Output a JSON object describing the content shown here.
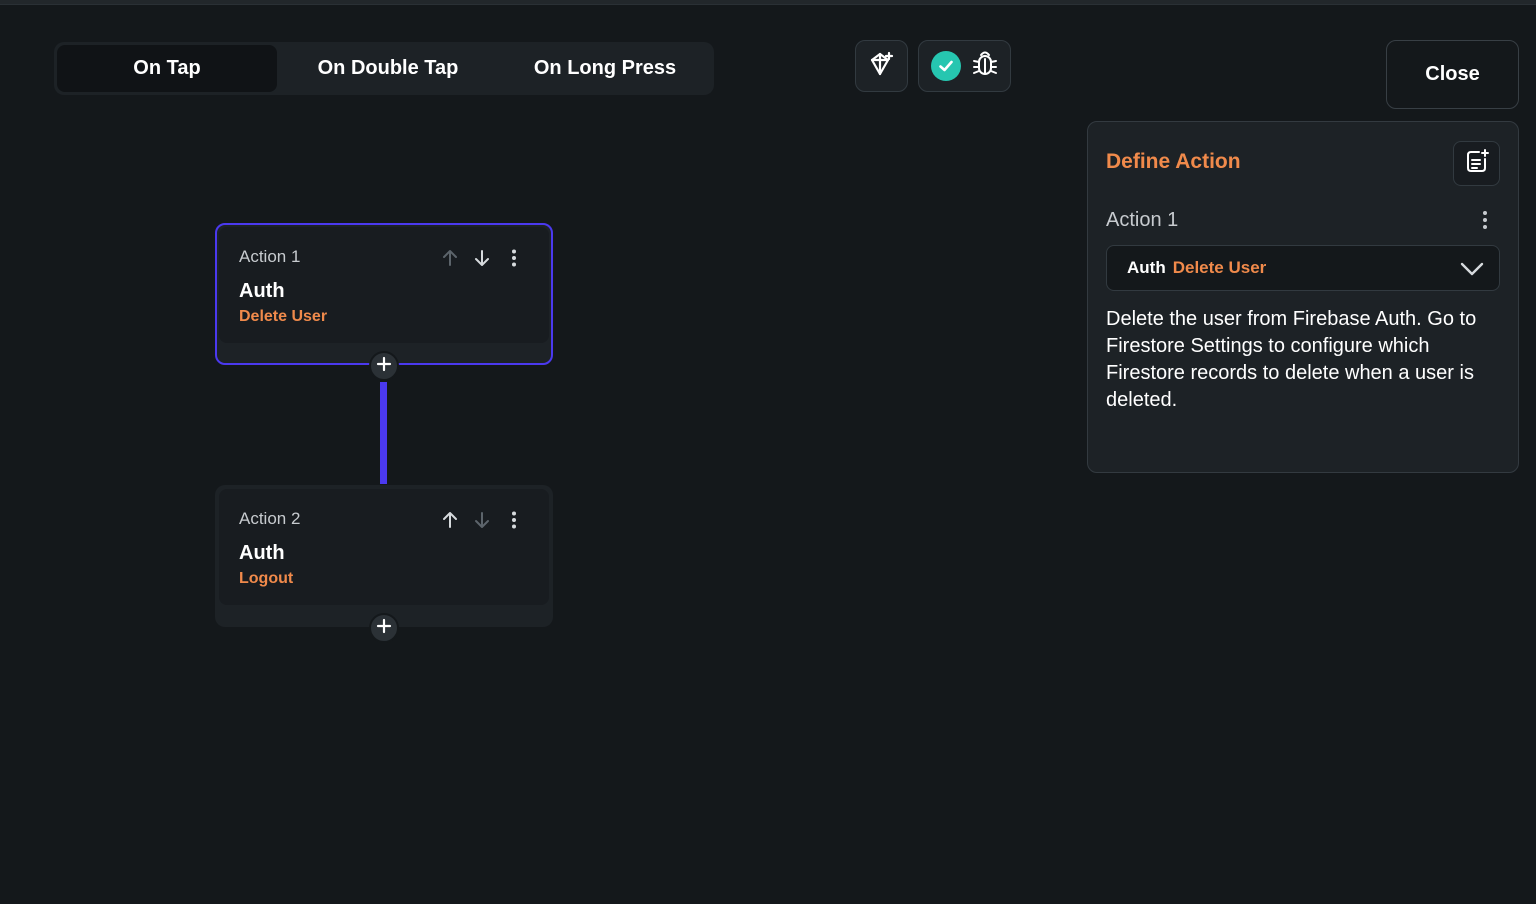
{
  "tabs": [
    {
      "label": "On Tap",
      "active": true
    },
    {
      "label": "On Double Tap",
      "active": false
    },
    {
      "label": "On Long Press",
      "active": false
    }
  ],
  "toolbar": {
    "left_icon": "ai-spark-icon",
    "status_icon": "check-circle-icon",
    "debug_icon": "bug-icon",
    "close_label": "Close"
  },
  "colors": {
    "background": "#14181b",
    "surface": "#1d2226",
    "accent": "#4b39ef",
    "action_orange": "#f08a4b",
    "success": "#26c6b0"
  },
  "actions": [
    {
      "label": "Action 1",
      "category": "Auth",
      "name": "Delete User",
      "selected": true
    },
    {
      "label": "Action 2",
      "category": "Auth",
      "name": "Logout",
      "selected": false
    }
  ],
  "panel": {
    "title": "Define Action",
    "action_label": "Action 1",
    "select_category": "Auth",
    "select_action": "Delete User",
    "description": "Delete the user from Firebase Auth. Go to Firestore Settings to configure which Firestore records to delete when a user is deleted."
  }
}
